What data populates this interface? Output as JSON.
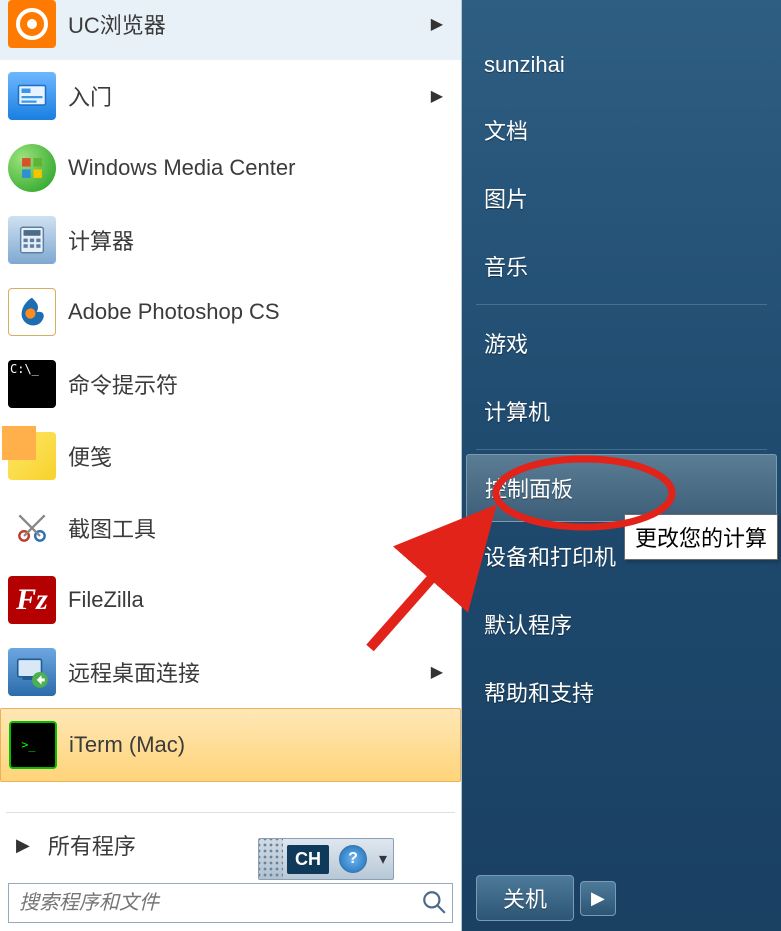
{
  "left": {
    "programs": [
      {
        "key": "uc",
        "label": "UC浏览器",
        "submenu": true
      },
      {
        "key": "getting_started",
        "label": "入门",
        "submenu": true
      },
      {
        "key": "wmc",
        "label": "Windows Media Center",
        "submenu": false
      },
      {
        "key": "calculator",
        "label": "计算器",
        "submenu": false
      },
      {
        "key": "photoshop",
        "label": "Adobe Photoshop CS",
        "submenu": false
      },
      {
        "key": "cmd",
        "label": "命令提示符",
        "submenu": false
      },
      {
        "key": "sticky",
        "label": "便笺",
        "submenu": false
      },
      {
        "key": "snip",
        "label": "截图工具",
        "submenu": false
      },
      {
        "key": "filezilla",
        "label": "FileZilla",
        "submenu": false
      },
      {
        "key": "rdp",
        "label": "远程桌面连接",
        "submenu": true
      },
      {
        "key": "iterm",
        "label": "iTerm (Mac)",
        "submenu": false,
        "highlighted": true
      }
    ],
    "all_programs_label": "所有程序",
    "search_placeholder": "搜索程序和文件"
  },
  "right": {
    "items": [
      {
        "key": "user",
        "label": "sunzihai"
      },
      {
        "key": "documents",
        "label": "文档"
      },
      {
        "key": "pictures",
        "label": "图片"
      },
      {
        "key": "music",
        "label": "音乐"
      },
      {
        "divider": true
      },
      {
        "key": "games",
        "label": "游戏"
      },
      {
        "key": "computer",
        "label": "计算机"
      },
      {
        "divider": true
      },
      {
        "key": "controlpanel",
        "label": "控制面板",
        "hovered": true
      },
      {
        "key": "devices",
        "label": "设备和打印机"
      },
      {
        "key": "default",
        "label": "默认程序"
      },
      {
        "key": "help",
        "label": "帮助和支持"
      }
    ],
    "shutdown_label": "关机"
  },
  "langbar": {
    "code": "CH",
    "help": "?"
  },
  "tooltip": "更改您的计算"
}
